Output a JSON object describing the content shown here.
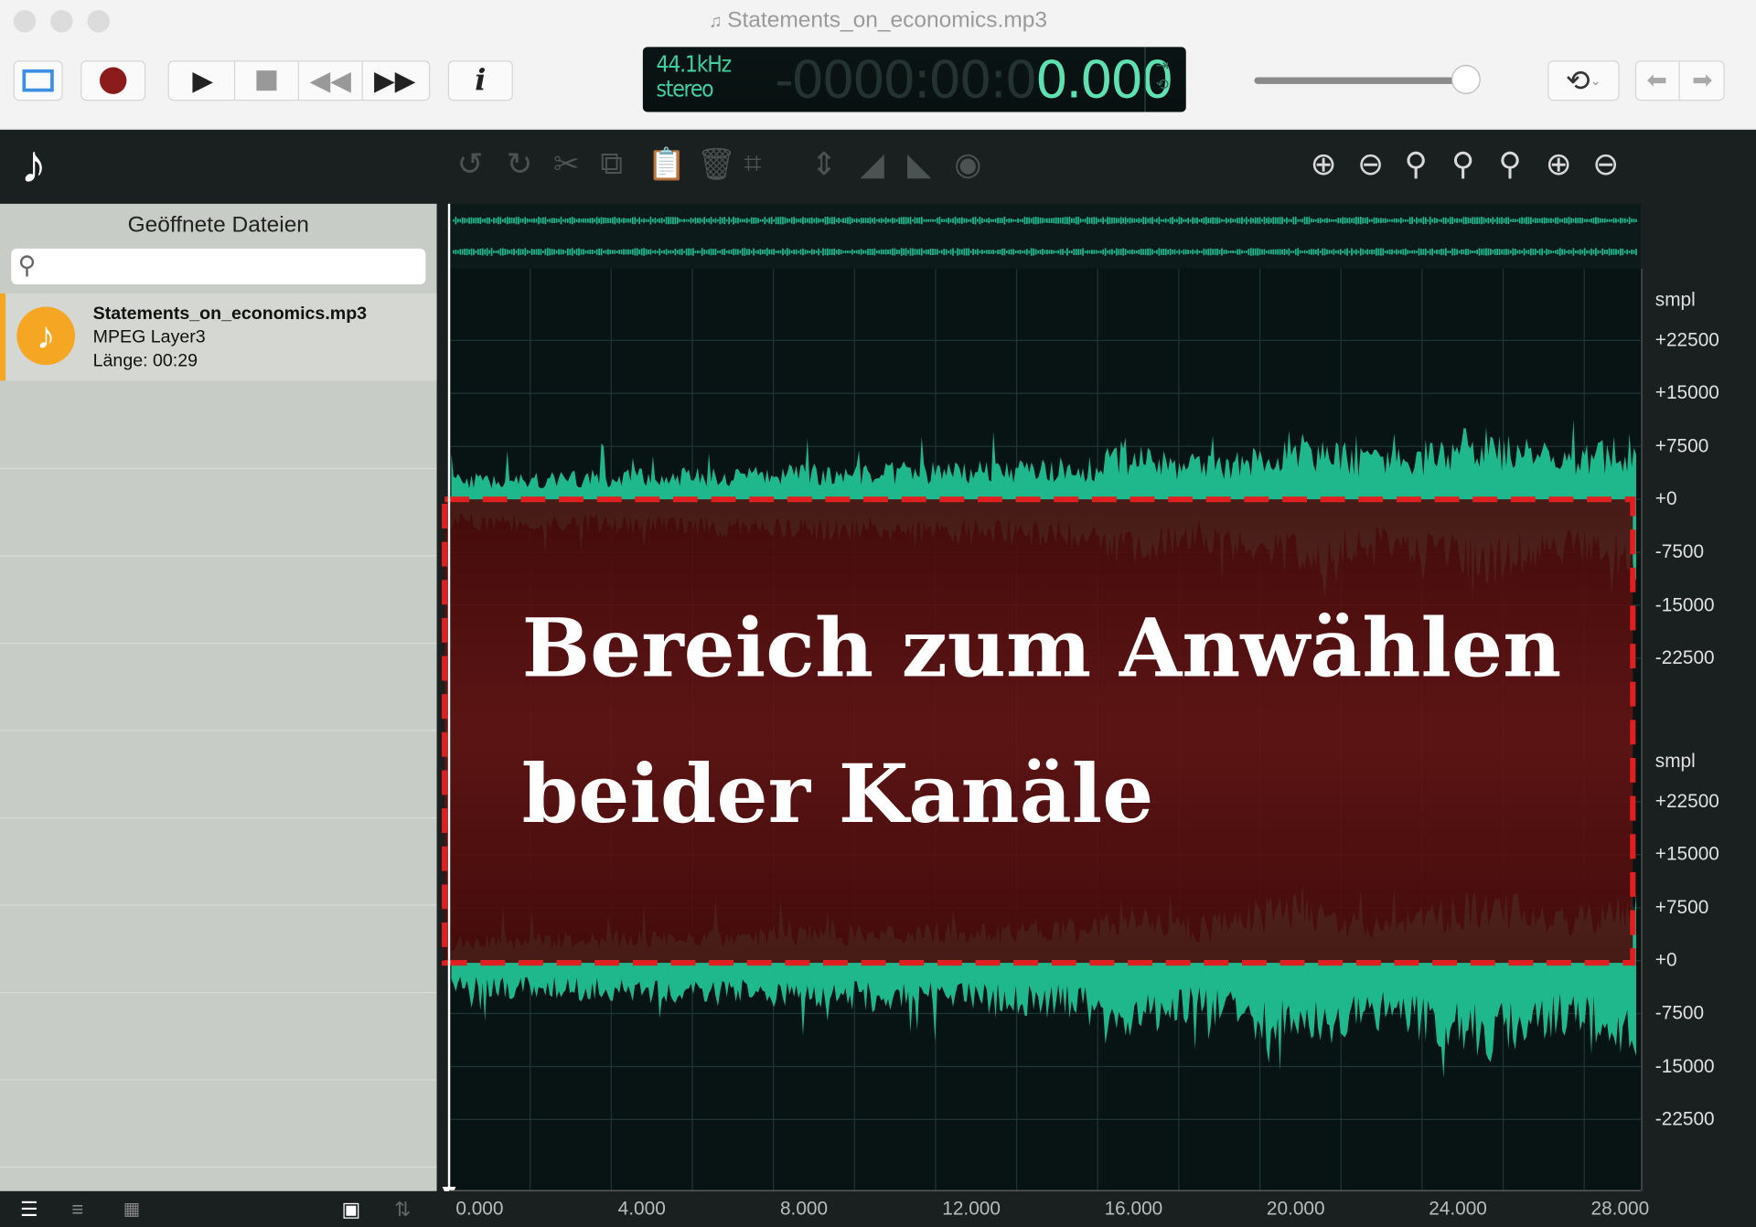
{
  "window": {
    "title": "Statements_on_economics.mp3"
  },
  "transport": {
    "buttons": [
      "view-toggle",
      "record",
      "play",
      "stop",
      "rewind",
      "fast-forward",
      "info"
    ],
    "info_label": "i"
  },
  "display": {
    "sample_rate": "44.1kHz",
    "channels": "stereo",
    "time_dim": "-0000:00:0",
    "time_lit": "0.000"
  },
  "volume": {
    "level": 0.93
  },
  "toolbar": {
    "edit_icons": [
      "undo",
      "redo",
      "cut",
      "copy",
      "paste",
      "delete",
      "crop",
      "normalize",
      "fade-in",
      "fade-out",
      "effects"
    ],
    "zoom_icons": [
      "zoom-in",
      "zoom-out",
      "zoom-fit",
      "zoom-selection",
      "zoom-back",
      "zoom-in-vertical",
      "zoom-out-vertical"
    ]
  },
  "sidebar": {
    "title": "Geöffnete Dateien",
    "search_placeholder": "",
    "files": [
      {
        "name": "Statements_on_economics.mp3",
        "format": "MPEG Layer3",
        "length": "Länge: 00:29"
      }
    ]
  },
  "waveform": {
    "channels": [
      {
        "unit": "smpl",
        "ticks": [
          "+22500",
          "+15000",
          "+7500",
          "+0",
          "-7500",
          "-15000",
          "-22500"
        ]
      },
      {
        "unit": "smpl",
        "ticks": [
          "+22500",
          "+15000",
          "+7500",
          "+0",
          "-7500",
          "-15000",
          "-22500"
        ]
      }
    ],
    "time_ticks": [
      "0.000",
      "4.000",
      "8.000",
      "12.000",
      "16.000",
      "20.000",
      "24.000",
      "28.000"
    ],
    "wave_color": "#1fb88c",
    "selection_color": "#e02020"
  },
  "annotation": {
    "line1": "Bereich zum Anwählen",
    "line2": "beider Kanäle"
  }
}
